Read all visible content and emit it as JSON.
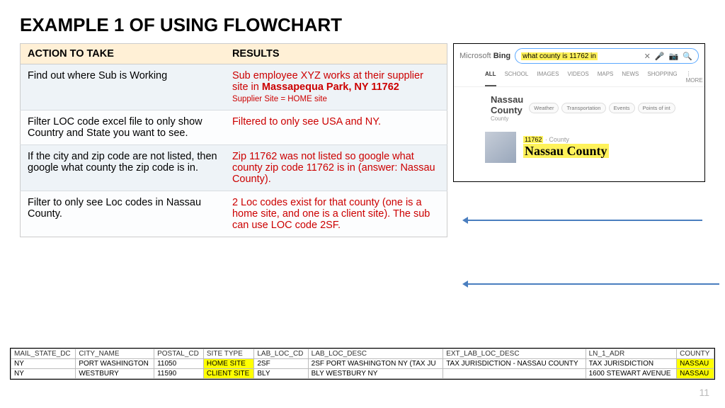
{
  "title": "EXAMPLE 1 OF USING FLOWCHART",
  "page_number": "11",
  "action_table": {
    "headers": [
      "ACTION TO TAKE",
      "RESULTS"
    ],
    "rows": [
      {
        "action": "Find out where Sub is Working",
        "result_prefix": "Sub employee XYZ works at their supplier site in ",
        "result_strong": "Massapequa Park, NY 11762",
        "result_note": "Supplier Site = HOME site"
      },
      {
        "action": "Filter LOC code excel file to only show Country and State you want to see.",
        "result": "Filtered to only see USA and NY."
      },
      {
        "action": "If the city and zip code are not listed, then google what county the zip code is in.",
        "result": "Zip 11762 was not listed so google what county zip code 11762 is in (answer: Nassau County)."
      },
      {
        "action": "Filter to only see Loc codes in Nassau County.",
        "result": "2 Loc codes exist for that county (one is a home site, and one is a client site). The sub can use LOC code 2SF."
      }
    ]
  },
  "bing": {
    "logo_prefix": "Microsoft ",
    "logo_bold": "Bing",
    "query": "what county is 11762 in",
    "close_icon": "✕",
    "mic_icon": "🎤",
    "lens_icon": "📷",
    "search_icon": "🔍",
    "tabs": [
      "ALL",
      "SCHOOL",
      "IMAGES",
      "VIDEOS",
      "MAPS",
      "NEWS",
      "SHOPPING",
      "⋮ MORE"
    ],
    "kg_title": "Nassau County",
    "kg_sub": "County",
    "chips": [
      "Weather",
      "Transportation",
      "Events",
      "Points of int"
    ],
    "result_zip": "11762",
    "result_gray": " · County",
    "result_county": "Nassau County"
  },
  "excel": {
    "headers": [
      "MAIL_STATE_DC",
      "CITY_NAME",
      "POSTAL_CD",
      "SITE TYPE",
      "LAB_LOC_CD",
      "LAB_LOC_DESC",
      "EXT_LAB_LOC_DESC",
      "LN_1_ADR",
      "COUNTY"
    ],
    "rows": [
      [
        "NY",
        "PORT WASHINGTON",
        "11050",
        "HOME SITE",
        "2SF",
        "2SF PORT WASHINGTON NY (TAX JU",
        "TAX JURISDICTION - NASSAU COUNTY",
        "TAX JURISDICTION",
        "NASSAU"
      ],
      [
        "NY",
        "WESTBURY",
        "11590",
        "CLIENT SITE",
        "BLY",
        "BLY WESTBURY NY",
        "",
        "1600 STEWART AVENUE",
        "NASSAU"
      ]
    ],
    "highlight_cols": {
      "site_type": 3,
      "county": 8
    }
  }
}
